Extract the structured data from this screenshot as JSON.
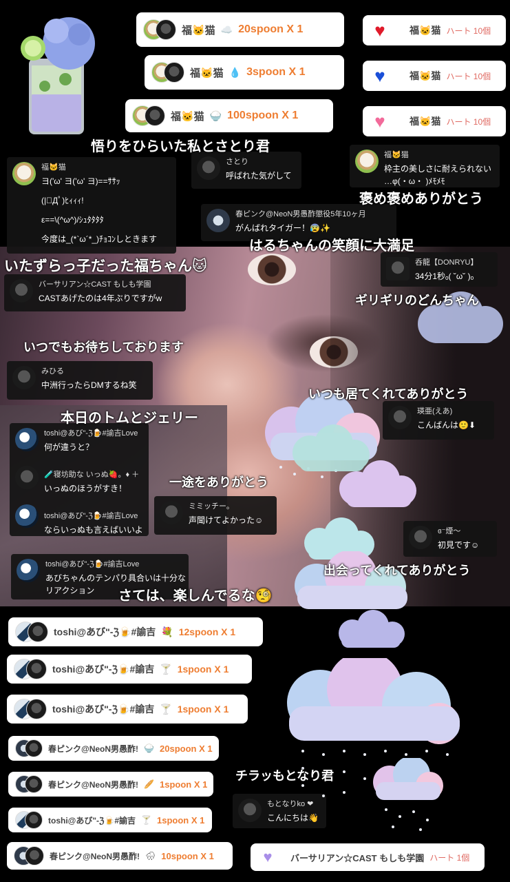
{
  "gifts_top": [
    {
      "name": "福🐱猫",
      "icon": "☁️",
      "amount": "20spoon X 1"
    },
    {
      "name": "福🐱猫",
      "icon": "💧",
      "amount": "3spoon X 1"
    },
    {
      "name": "福🐱猫",
      "icon": "🍚",
      "amount": "100spoon X 1"
    }
  ],
  "hearts": [
    {
      "name": "福🐱猫",
      "label": "ハート 10個",
      "color": "#e01a2a"
    },
    {
      "name": "福🐱猫",
      "label": "ハート 10個",
      "color": "#1a4fd8"
    },
    {
      "name": "福🐱猫",
      "label": "ハート 10個",
      "color": "#f26a9a"
    }
  ],
  "captions": {
    "c1": "悟りをひらいた私とさとり君",
    "c2": "褒め褒めありがとう",
    "c3": "はるちゃんの笑顔に大満足",
    "c4": "いたずらっ子だった福ちゃん🐱",
    "c5": "ギリギリのどんちゃん",
    "c6": "いつでもお待ちしております",
    "c7": "いつも居てくれてありがとう",
    "c8": "本日のトムとジェリー",
    "c9": "一途をありがとう",
    "c10": "出会ってくれてありがとう",
    "c11": "さては、楽しんでるな🧐",
    "c12": "チラッもとなり君"
  },
  "comments": {
    "fuku": {
      "name": "福🐱猫",
      "lines": [
        "ヨ('ω' ヨ('ω' ヨ)==ｻｻｯ",
        "(|ﾟДﾟ)ﾋｨｨｨ!",
        "ε==\\(^ω^)/ｼｭﾀﾀﾀﾀ",
        "今度は_(*`ω´*_)ﾁｮｺﾝしときます"
      ]
    },
    "satori": {
      "name": "さとり",
      "text": "呼ばれた気がして"
    },
    "fuku2": {
      "name": "福🐱猫",
      "lines": [
        "枠主の美しさに耐えられない",
        "…φ(・ω・ )ﾒﾓﾒﾓ"
      ]
    },
    "haru": {
      "name": "春ピンク@NeoN男愚酢懲役5年10ヶ月",
      "text": "がんばれタイガー！😰✨"
    },
    "donryu": {
      "name": "呑龍【DONRYU】",
      "text": "34分1秒ₒ( ˘ω˘ )ₒ"
    },
    "versa": {
      "name": "バーサリアン☆CAST もしも学園",
      "text": "CASTあげたのは4年ぶりですがw"
    },
    "mihiru": {
      "name": "みひる",
      "text": "中洲行ったらDMするね笑"
    },
    "eia": {
      "name": "瑛亜(えあ)",
      "text": "こんばんは🙂⬇"
    },
    "toshi1": {
      "name": "toshi@あび\"-ℨ🍺#諭吉Love",
      "text": "何が違うと？"
    },
    "nebo": {
      "name": "🧪寝坊助な いっぬ🍓。♦ ＋",
      "text": "いっぬのほうがすき！"
    },
    "toshi2": {
      "name": "toshi@あび\"-ℨ🍺#諭吉Love",
      "text": "ならいっぬも言えばいいよ"
    },
    "mimi": {
      "name": "ミミッチー。",
      "text": "声聞けてよかった☺"
    },
    "kemuri": {
      "name": "ɞ⁻煙～",
      "text": "初見です☺"
    },
    "toshi3": {
      "name": "toshi@あび\"-ℨ🍺#諭吉Love",
      "lines": [
        "あびちゃんのテンパり具合いは十分な",
        "リアクション"
      ]
    },
    "motonari": {
      "name": "もとなりko ❤",
      "text": "こんにちは👋"
    }
  },
  "gifts_bottom": [
    {
      "name": "toshi@あび\"-ℨ🍺#諭吉",
      "icon": "💐",
      "amount": "12spoon X 1"
    },
    {
      "name": "toshi@あび\"-ℨ🍺#諭吉",
      "icon": "🍸",
      "amount": "1spoon X 1"
    },
    {
      "name": "toshi@あび\"-ℨ🍺#諭吉",
      "icon": "🍸",
      "amount": "1spoon X 1"
    },
    {
      "name": "春ピンク@NeoN男愚酢!",
      "icon": "🍚",
      "amount": "20spoon X 1"
    },
    {
      "name": "春ピンク@NeoN男愚酢!",
      "icon": "🥖",
      "amount": "1spoon X 1"
    },
    {
      "name": "toshi@あび\"-ℨ🍺#諭吉",
      "icon": "🍸",
      "amount": "1spoon X 1"
    },
    {
      "name": "春ピンク@NeoN男愚酢!",
      "icon": "🌧",
      "amount": "10spoon X 1"
    }
  ],
  "heart_bottom": {
    "name": "バーサリアン☆CAST もしも学園",
    "label": "ハート 1個"
  }
}
